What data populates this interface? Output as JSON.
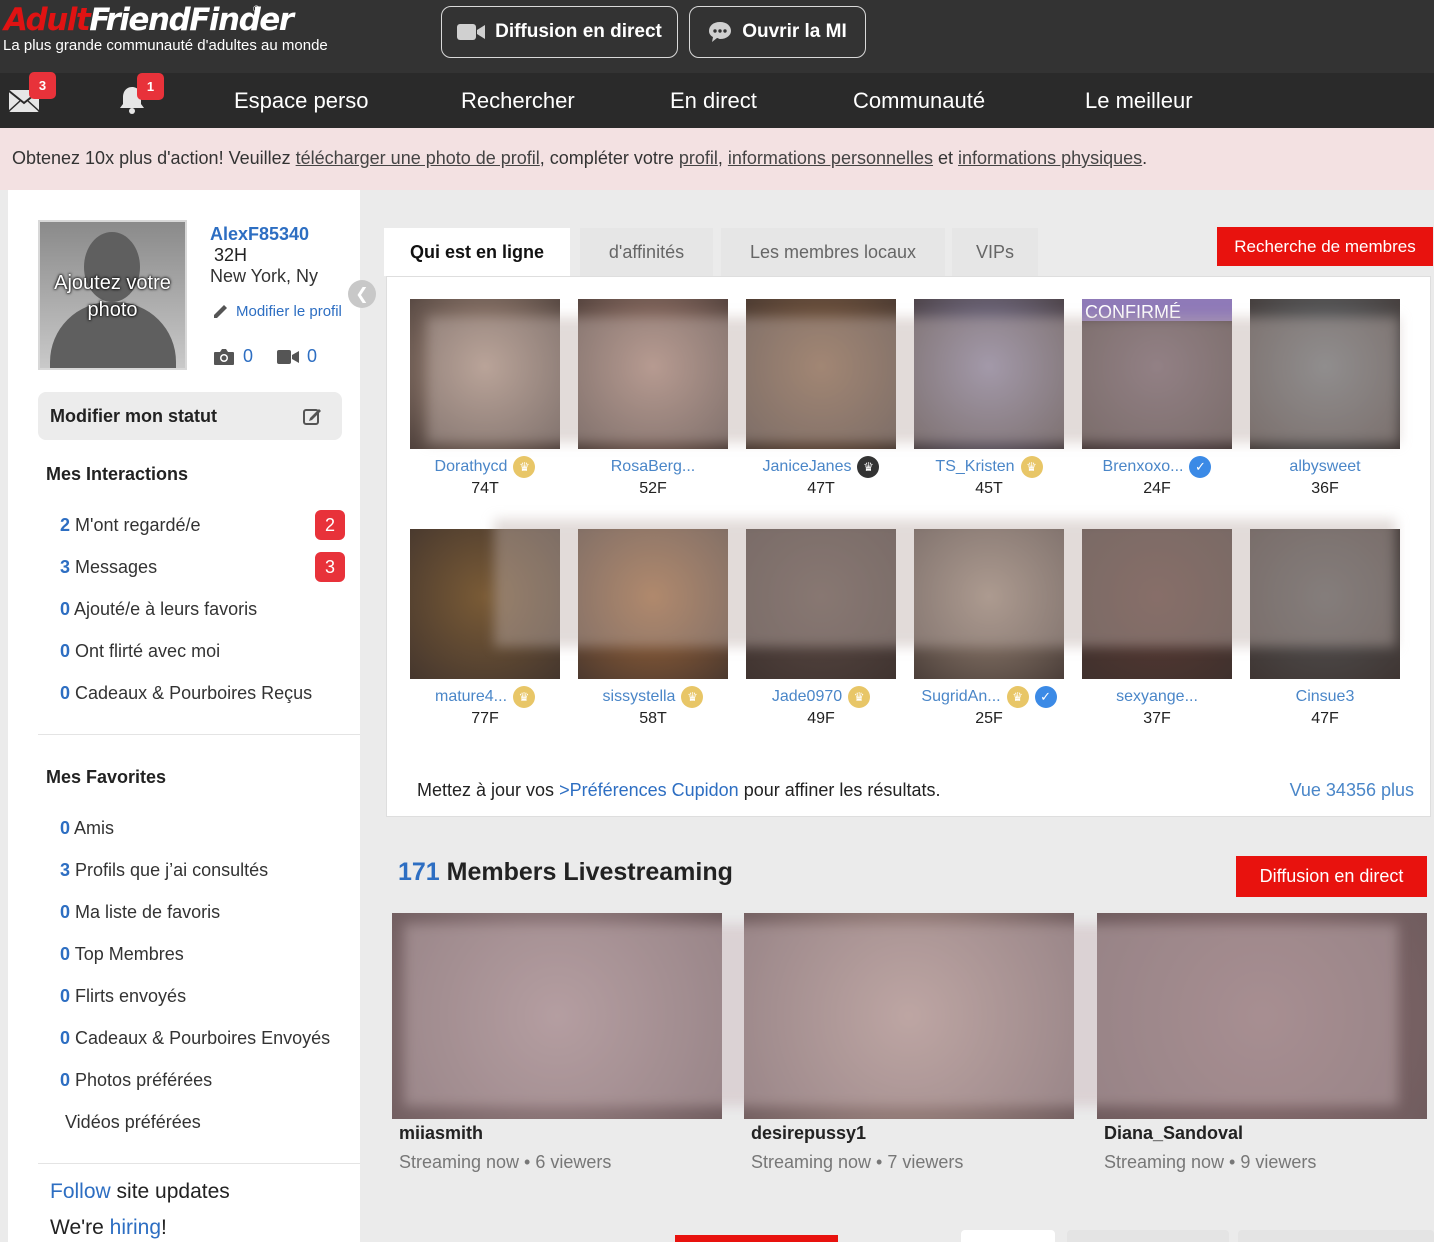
{
  "header": {
    "logo_part1": "Adult",
    "logo_part2": "FriendFinder",
    "logo_reg": "®",
    "tagline": "La plus grande communauté d'adultes au monde",
    "live_button": "Diffusion en direct",
    "chat_button": "Ouvrir la MI"
  },
  "nav": {
    "mail_badge": "3",
    "bell_badge": "1",
    "items": [
      "Espace perso",
      "Rechercher",
      "En direct",
      "Communauté",
      "Le meilleur"
    ]
  },
  "banner": {
    "t1": "Obtenez 10x plus d'action! Veuillez ",
    "l1": "télécharger une photo de profil",
    "t2": ", compléter votre ",
    "l2": "profil",
    "t3": ", ",
    "l3": "informations personnelles",
    "t4": " et ",
    "l4": "informations physiques",
    "t5": "."
  },
  "profile": {
    "avatar_text": "Ajoutez votre photo",
    "username": "AlexF85340",
    "age": "32H",
    "location": "New York, Ny",
    "edit_label": "Modifier le profil",
    "photo_count": "0",
    "video_count": "0",
    "status_button": "Modifier mon statut"
  },
  "interactions": {
    "title": "Mes Interactions",
    "items": [
      {
        "count": "2",
        "label": "M'ont regardé/e",
        "badge": "2"
      },
      {
        "count": "3",
        "label": "Messages",
        "badge": "3"
      },
      {
        "count": "0",
        "label": "Ajouté/e à leurs favoris"
      },
      {
        "count": "0",
        "label": "Ont flirté avec moi"
      },
      {
        "count": "0",
        "label": "Cadeaux & Pourboires Reçus"
      }
    ]
  },
  "favorites": {
    "title": "Mes Favorites",
    "items": [
      {
        "count": "0",
        "label": "Amis"
      },
      {
        "count": "3",
        "label": "Profils que j’ai consultés"
      },
      {
        "count": "0",
        "label": "Ma liste de favoris"
      },
      {
        "count": "0",
        "label": "Top Membres"
      },
      {
        "count": "0",
        "label": "Flirts envoyés"
      },
      {
        "count": "0",
        "label": "Cadeaux & Pourboires Envoyés"
      },
      {
        "count": "0",
        "label": "Photos préférées"
      },
      {
        "count": "",
        "label": "Vidéos préférées"
      }
    ]
  },
  "footer_links": {
    "follow_link": "Follow",
    "follow_text": " site updates",
    "hiring_prefix": "We're ",
    "hiring_link": "hiring",
    "hiring_suffix": "!"
  },
  "online": {
    "tabs": [
      "Qui est en ligne",
      "d'affinités",
      "Les membres locaux",
      "VIPs"
    ],
    "search_button": "Recherche de membres",
    "confirmed_label": "CONFIRMÉ",
    "members": [
      {
        "name": "Dorathycd",
        "age": "74T",
        "crown": "gold",
        "verified": false,
        "color": "#b59a8a"
      },
      {
        "name": "RosaBerg...",
        "age": "52F",
        "crown": "",
        "verified": false,
        "color": "#b08a7c"
      },
      {
        "name": "JaniceJanes",
        "age": "47T",
        "crown": "dark",
        "verified": false,
        "color": "#8a6547"
      },
      {
        "name": "TS_Kristen",
        "age": "45T",
        "crown": "gold",
        "verified": false,
        "color": "#8c87a8"
      },
      {
        "name": "Brenxoxo...",
        "age": "24F",
        "crown": "",
        "verified": true,
        "color": "#6e5a66"
      },
      {
        "name": "albysweet",
        "age": "36F",
        "crown": "",
        "verified": false,
        "color": "#6a7276"
      },
      {
        "name": "mature4...",
        "age": "77F",
        "crown": "gold",
        "verified": false,
        "color": "#7a5b36"
      },
      {
        "name": "sissystella",
        "age": "58T",
        "crown": "gold",
        "verified": false,
        "color": "#a46a3b"
      },
      {
        "name": "Jade0970",
        "age": "49F",
        "crown": "gold",
        "verified": false,
        "color": "#5b4a44"
      },
      {
        "name": "SugridAn...",
        "age": "25F",
        "crown": "gold",
        "verified": true,
        "color": "#9e8a7a"
      },
      {
        "name": "sexyange...",
        "age": "37F",
        "crown": "",
        "verified": false,
        "color": "#5a3a33"
      },
      {
        "name": "Cinsue3",
        "age": "47F",
        "crown": "",
        "verified": false,
        "color": "#555555"
      }
    ],
    "cupid_text1": "Mettez à jour vos ",
    "cupid_link": ">Préférences Cupidon",
    "cupid_text2": " pour affiner les résultats.",
    "view_more": "Vue 34356 plus"
  },
  "livestream": {
    "count": "171",
    "title": " Members Livestreaming",
    "button": "Diffusion en direct",
    "streams": [
      {
        "name": "miiasmith",
        "status": "Streaming now • 6 viewers",
        "color": "#a58c8e"
      },
      {
        "name": "desirepussy1",
        "status": "Streaming now • 7 viewers",
        "color": "#b59a92"
      },
      {
        "name": "Diana_Sandoval",
        "status": "Streaming now • 9 viewers",
        "color": "#8d7072"
      }
    ]
  }
}
